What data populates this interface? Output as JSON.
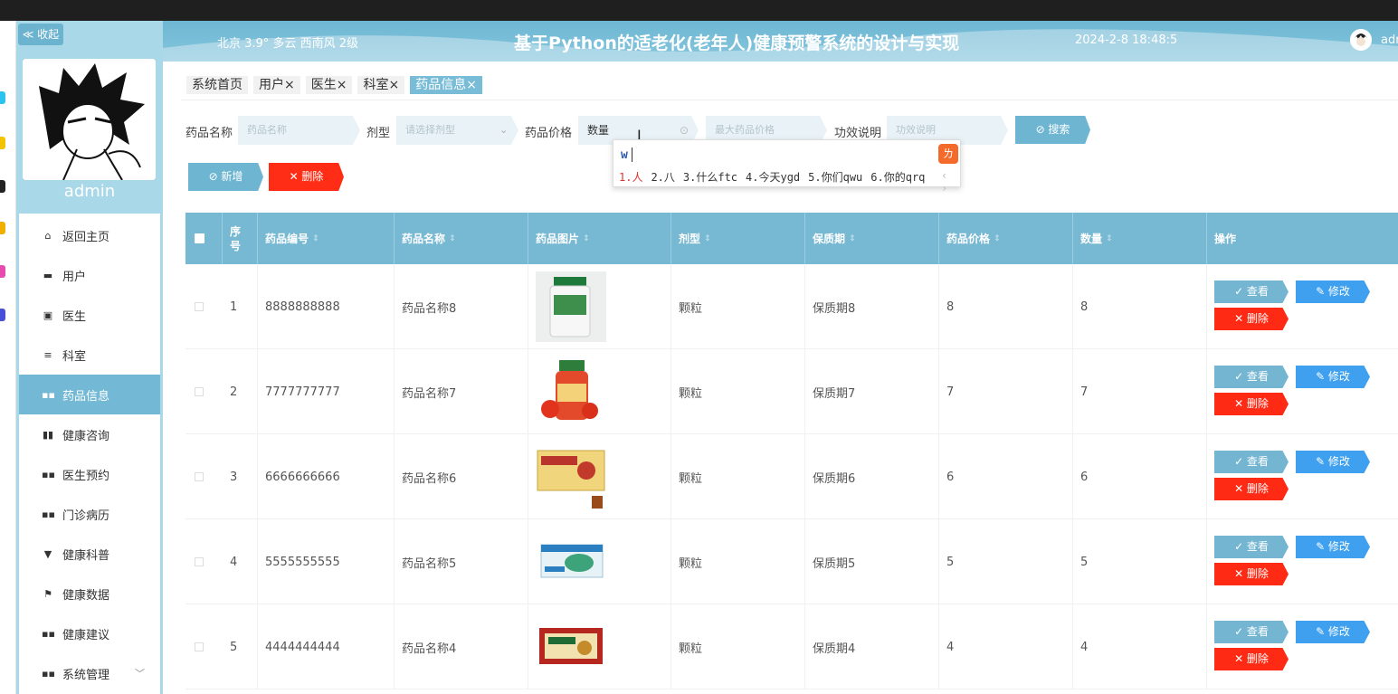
{
  "header": {
    "weather": "北京  3.9°  多云  西南风  2级",
    "title": "基于Python的适老化(老年人)健康预警系统的设计与实现",
    "datetime": "2024-2-8 18:48:5",
    "user": "adm"
  },
  "sidebar": {
    "collapse_label": "≪ 收起",
    "username": "admin",
    "items": [
      {
        "label": "返回主页",
        "icon": "⌂"
      },
      {
        "label": "用户",
        "icon": "▬"
      },
      {
        "label": "医生",
        "icon": "▣"
      },
      {
        "label": "科室",
        "icon": "≡"
      },
      {
        "label": "药品信息",
        "icon": "▪▪"
      },
      {
        "label": "健康咨询",
        "icon": "▮▮"
      },
      {
        "label": "医生预约",
        "icon": "▪▪"
      },
      {
        "label": "门诊病历",
        "icon": "▪▪"
      },
      {
        "label": "健康科普",
        "icon": "▼"
      },
      {
        "label": "健康数据",
        "icon": "⚑"
      },
      {
        "label": "健康建议",
        "icon": "▪▪"
      },
      {
        "label": "系统管理",
        "icon": "▪▪"
      }
    ]
  },
  "tabs": [
    {
      "label": "系统首页"
    },
    {
      "label": "用户×"
    },
    {
      "label": "医生×"
    },
    {
      "label": "科室×"
    },
    {
      "label": "药品信息×"
    }
  ],
  "search": {
    "name_label": "药品名称",
    "name_placeholder": "药品名称",
    "type_label": "剂型",
    "type_placeholder": "请选择剂型",
    "price_label": "药品价格",
    "price_value": "数量",
    "price_max_placeholder": "最大药品价格",
    "effect_label": "功效说明",
    "effect_placeholder": "功效说明",
    "search_button": "⊘ 搜索"
  },
  "actions": {
    "add_button": "⊘ 新增",
    "delete_button": "✕ 删除"
  },
  "ime": {
    "typed": "w",
    "candidates": [
      "1.人",
      "2.八",
      "3.什么ftc",
      "4.今天ygd",
      "5.你们qwu",
      "6.你的qrq"
    ],
    "pager": "‹ ›"
  },
  "table": {
    "columns": [
      "序号",
      "药品编号",
      "药品名称",
      "药品图片",
      "剂型",
      "保质期",
      "药品价格",
      "数量",
      "操作"
    ],
    "sort_glyph": "⇕",
    "rows": [
      {
        "index": "1",
        "code": "8888888888",
        "name": "药品名称8",
        "type": "颗粒",
        "shelf": "保质期8",
        "price": "8",
        "qty": "8"
      },
      {
        "index": "2",
        "code": "7777777777",
        "name": "药品名称7",
        "type": "颗粒",
        "shelf": "保质期7",
        "price": "7",
        "qty": "7"
      },
      {
        "index": "3",
        "code": "6666666666",
        "name": "药品名称6",
        "type": "颗粒",
        "shelf": "保质期6",
        "price": "6",
        "qty": "6"
      },
      {
        "index": "4",
        "code": "5555555555",
        "name": "药品名称5",
        "type": "颗粒",
        "shelf": "保质期5",
        "price": "5",
        "qty": "5"
      },
      {
        "index": "5",
        "code": "4444444444",
        "name": "药品名称4",
        "type": "颗粒",
        "shelf": "保质期4",
        "price": "4",
        "qty": "4"
      }
    ],
    "op_view": "✓ 查看",
    "op_edit": "✎ 修改",
    "op_delete": "✕ 删除"
  },
  "colors": {
    "theme": "#77b8d3",
    "danger": "#ff2d16",
    "edit": "#3ea0ee",
    "sidebar_bg": "#a9d8e8"
  }
}
